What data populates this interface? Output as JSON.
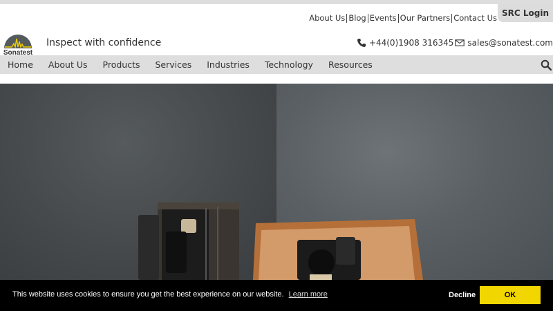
{
  "header": {
    "top_links": [
      {
        "label": "About Us"
      },
      {
        "label": "Blog"
      },
      {
        "label": "Events"
      },
      {
        "label": "Our Partners"
      },
      {
        "label": "Contact Us"
      }
    ],
    "login_label": "SRC Login",
    "brand_name": "Sonatest",
    "tagline": "Inspect with confidence",
    "phone": "+44(0)1908 316345",
    "email": "sales@sonatest.com"
  },
  "nav": {
    "items": [
      {
        "label": "Home"
      },
      {
        "label": "About Us"
      },
      {
        "label": "Products"
      },
      {
        "label": "Services"
      },
      {
        "label": "Industries"
      },
      {
        "label": "Technology"
      },
      {
        "label": "Resources"
      }
    ],
    "search_icon": "search-icon"
  },
  "cookie": {
    "message": "This website uses cookies to ensure you get the best experience on our website.",
    "learn_more": "Learn more",
    "decline": "Decline",
    "ok": "OK"
  },
  "colors": {
    "nav_bg": "#dedede",
    "cookie_bg": "#000000",
    "ok_button": "#f1d600",
    "logo_accent": "#f0d000"
  }
}
